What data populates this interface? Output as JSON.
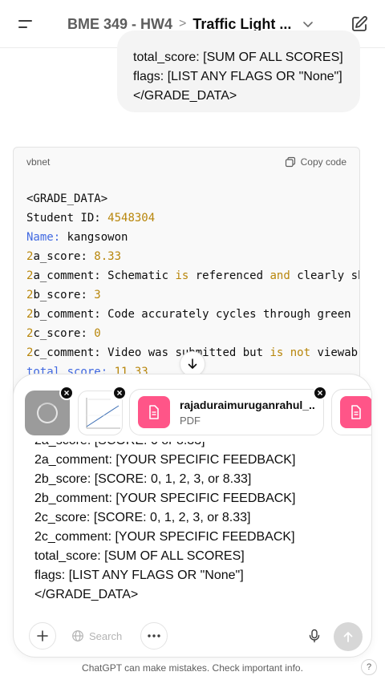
{
  "header": {
    "project": "BME 349 - HW4",
    "separator": ">",
    "conversation_title": "Traffic Light ..."
  },
  "user_message": {
    "lines": [
      "total_score: [SUM OF ALL SCORES]",
      "flags: [LIST ANY FLAGS OR \"None\"]",
      "</GRADE_DATA>"
    ]
  },
  "code_block": {
    "language": "vbnet",
    "copy_label": "Copy code",
    "lines": [
      [
        {
          "t": "<GRADE_DATA>",
          "c": ""
        }
      ],
      [
        {
          "t": "Student ID: ",
          "c": ""
        },
        {
          "t": "4548304",
          "c": "num"
        }
      ],
      [
        {
          "t": "Name:",
          "c": "name"
        },
        {
          "t": " kangsowon",
          "c": ""
        }
      ],
      [
        {
          "t": "2",
          "c": "num"
        },
        {
          "t": "a_score: ",
          "c": ""
        },
        {
          "t": "8.33",
          "c": "num"
        }
      ],
      [
        {
          "t": "2",
          "c": "num"
        },
        {
          "t": "a_comment: Schematic ",
          "c": ""
        },
        {
          "t": "is",
          "c": "kw"
        },
        {
          "t": " referenced ",
          "c": ""
        },
        {
          "t": "and",
          "c": "kw"
        },
        {
          "t": " clearly sh",
          "c": ""
        }
      ],
      [
        {
          "t": "2",
          "c": "num"
        },
        {
          "t": "b_score: ",
          "c": ""
        },
        {
          "t": "3",
          "c": "num"
        }
      ],
      [
        {
          "t": "2",
          "c": "num"
        },
        {
          "t": "b_comment: Code accurately cycles through green",
          "c": ""
        }
      ],
      [
        {
          "t": "2",
          "c": "num"
        },
        {
          "t": "c_score: ",
          "c": ""
        },
        {
          "t": "0",
          "c": "num"
        }
      ],
      [
        {
          "t": "2",
          "c": "num"
        },
        {
          "t": "c_comment: Video was submitted but ",
          "c": ""
        },
        {
          "t": "is",
          "c": "kw"
        },
        {
          "t": " ",
          "c": ""
        },
        {
          "t": "not",
          "c": "kw"
        },
        {
          "t": " viewab",
          "c": ""
        }
      ],
      [
        {
          "t": "total_score:",
          "c": "name"
        },
        {
          "t": " ",
          "c": ""
        },
        {
          "t": "11.33",
          "c": "num"
        }
      ]
    ]
  },
  "attachments": {
    "file_name": "rajaduraimuruganrahul_...",
    "file_type": "PDF",
    "remove_symbol": "×"
  },
  "composer": {
    "lines": [
      "2a_score: [SCORE: 0 or 8.33]",
      "2a_comment: [YOUR SPECIFIC FEEDBACK]",
      "2b_score: [SCORE: 0, 1, 2, 3, or 8.33]",
      "2b_comment: [YOUR SPECIFIC FEEDBACK]",
      "2c_score: [SCORE: 0, 1, 2, 3, or 8.33]",
      "2c_comment: [YOUR SPECIFIC FEEDBACK]",
      "total_score: [SUM OF ALL SCORES]",
      "flags: [LIST ANY FLAGS OR \"None\"]",
      "</GRADE_DATA>"
    ],
    "search_label": "Search"
  },
  "footer": {
    "disclaimer": "ChatGPT can make mistakes. Check important info.",
    "help": "?"
  },
  "icons": {
    "menu": "menu-icon",
    "edit": "new-chat-icon",
    "copy": "copy-icon",
    "scroll": "arrow-down-icon",
    "plus": "plus-icon",
    "globe": "globe-icon",
    "more": "more-icon",
    "mic": "microphone-icon",
    "send": "arrow-up-icon",
    "file": "document-icon"
  },
  "colors": {
    "file_icon": "#ff5588",
    "code_number": "#b8860b",
    "code_keyword": "#b8860b",
    "code_name": "#4169e1"
  }
}
